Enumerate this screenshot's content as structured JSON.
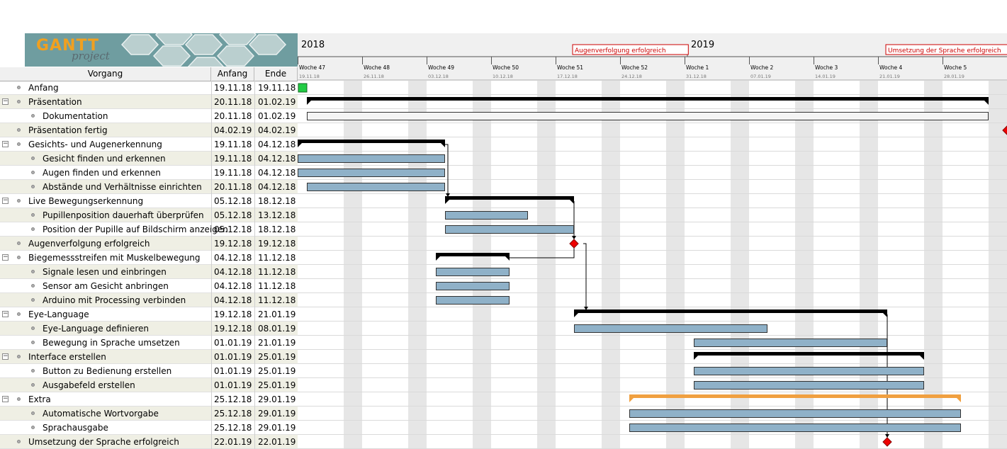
{
  "logo": {
    "word1": "GANTT",
    "word2": "project"
  },
  "table": {
    "col_name": "Vorgang",
    "col_start": "Anfang",
    "col_end": "Ende",
    "rows": [
      {
        "name": "Anfang",
        "start": "19.11.18",
        "end": "19.11.18",
        "level": 0,
        "group": false
      },
      {
        "name": "Präsentation",
        "start": "20.11.18",
        "end": "01.02.19",
        "level": 0,
        "group": true
      },
      {
        "name": "Dokumentation",
        "start": "20.11.18",
        "end": "01.02.19",
        "level": 1,
        "group": false
      },
      {
        "name": "Präsentation fertig",
        "start": "04.02.19",
        "end": "04.02.19",
        "level": 0,
        "group": false
      },
      {
        "name": "Gesichts- und Augenerkennung",
        "start": "19.11.18",
        "end": "04.12.18",
        "level": 0,
        "group": true
      },
      {
        "name": "Gesicht finden und erkennen",
        "start": "19.11.18",
        "end": "04.12.18",
        "level": 1,
        "group": false
      },
      {
        "name": "Augen finden und erkennen",
        "start": "19.11.18",
        "end": "04.12.18",
        "level": 1,
        "group": false
      },
      {
        "name": "Abstände und Verhältnisse einrichten",
        "start": "20.11.18",
        "end": "04.12.18",
        "level": 1,
        "group": false
      },
      {
        "name": "Live Bewegungserkennung",
        "start": "05.12.18",
        "end": "18.12.18",
        "level": 0,
        "group": true
      },
      {
        "name": "Pupillenposition dauerhaft überprüfen",
        "start": "05.12.18",
        "end": "13.12.18",
        "level": 1,
        "group": false
      },
      {
        "name": "Position der Pupille auf Bildschirm anzeigen",
        "start": "05.12.18",
        "end": "18.12.18",
        "level": 1,
        "group": false
      },
      {
        "name": "Augenverfolgung erfolgreich",
        "start": "19.12.18",
        "end": "19.12.18",
        "level": 0,
        "group": false
      },
      {
        "name": "Biegemessstreifen mit Muskelbewegung",
        "start": "04.12.18",
        "end": "11.12.18",
        "level": 0,
        "group": true
      },
      {
        "name": "Signale lesen und einbringen",
        "start": "04.12.18",
        "end": "11.12.18",
        "level": 1,
        "group": false
      },
      {
        "name": "Sensor am Gesicht anbringen",
        "start": "04.12.18",
        "end": "11.12.18",
        "level": 1,
        "group": false
      },
      {
        "name": "Arduino mit Processing verbinden",
        "start": "04.12.18",
        "end": "11.12.18",
        "level": 1,
        "group": false
      },
      {
        "name": "Eye-Language",
        "start": "19.12.18",
        "end": "21.01.19",
        "level": 0,
        "group": true
      },
      {
        "name": "Eye-Language definieren",
        "start": "19.12.18",
        "end": "08.01.19",
        "level": 1,
        "group": false
      },
      {
        "name": "Bewegung in Sprache umsetzen",
        "start": "01.01.19",
        "end": "21.01.19",
        "level": 1,
        "group": false
      },
      {
        "name": "Interface erstellen",
        "start": "01.01.19",
        "end": "25.01.19",
        "level": 0,
        "group": true
      },
      {
        "name": "Button zu Bedienung erstellen",
        "start": "01.01.19",
        "end": "25.01.19",
        "level": 1,
        "group": false
      },
      {
        "name": "Ausgabefeld erstellen",
        "start": "01.01.19",
        "end": "25.01.19",
        "level": 1,
        "group": false
      },
      {
        "name": "Extra",
        "start": "25.12.18",
        "end": "29.01.19",
        "level": 0,
        "group": true
      },
      {
        "name": "Automatische Wortvorgabe",
        "start": "25.12.18",
        "end": "29.01.19",
        "level": 1,
        "group": false
      },
      {
        "name": "Sprachausgabe",
        "start": "25.12.18",
        "end": "29.01.19",
        "level": 1,
        "group": false
      },
      {
        "name": "Umsetzung der Sprache erfolgreich",
        "start": "22.01.19",
        "end": "22.01.19",
        "level": 0,
        "group": false
      }
    ]
  },
  "timeline": {
    "years": [
      "2018",
      "2019"
    ],
    "weeks": [
      {
        "label": "Woche 47",
        "date": "19.11.18"
      },
      {
        "label": "Woche 48",
        "date": "26.11.18"
      },
      {
        "label": "Woche 49",
        "date": "03.12.18"
      },
      {
        "label": "Woche 50",
        "date": "10.12.18"
      },
      {
        "label": "Woche 51",
        "date": "17.12.18"
      },
      {
        "label": "Woche 52",
        "date": "24.12.18"
      },
      {
        "label": "Woche 1",
        "date": "31.12.18"
      },
      {
        "label": "Woche 2",
        "date": "07.01.19"
      },
      {
        "label": "Woche 3",
        "date": "14.01.19"
      },
      {
        "label": "Woche 4",
        "date": "21.01.19"
      },
      {
        "label": "Woche 5",
        "date": "28.01.19"
      }
    ],
    "milestone_labels": [
      "Augenverfolgung erfolgreich",
      "Umsetzung der Sprache erfolgreich"
    ]
  },
  "colors": {
    "task_bar": "#8fb1c8",
    "group_bar": "#000000",
    "extra_group_bar": "#f0a040",
    "milestone": "#ee0000",
    "start_marker": "#22cc44",
    "weekend_stripe": "#e6e6e6",
    "milestone_label_border": "#cc0000",
    "milestone_label_text": "#cc0000"
  }
}
